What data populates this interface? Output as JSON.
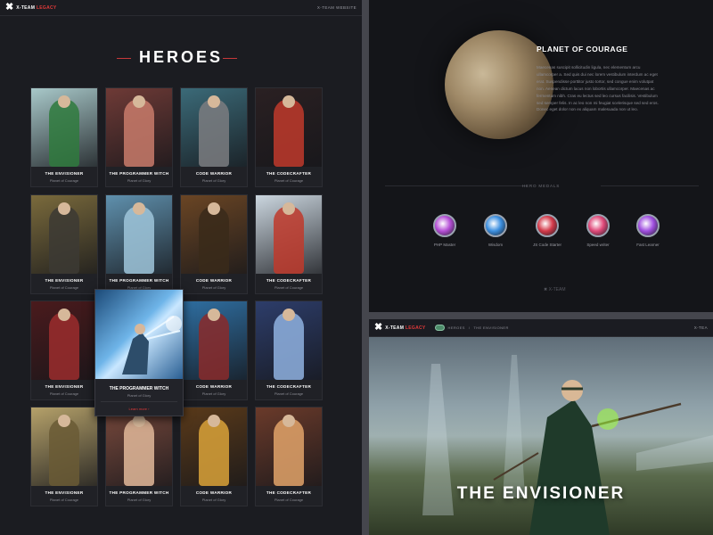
{
  "brand": {
    "name": "X-TEAM",
    "sub": "LEGACY"
  },
  "left": {
    "top_link": "X-TEAM WEBSITE",
    "title": "HEROES",
    "cards": [
      {
        "name": "THE ENVISIONER",
        "planet": "Planet of Courage",
        "bg": "#a8c8c9",
        "accent": "#2f7a3d"
      },
      {
        "name": "THE PROGRAMMER WITCH",
        "planet": "Planet of Glory",
        "bg": "#6e3a36",
        "accent": "#c97b6b"
      },
      {
        "name": "CODE WARRIOR",
        "planet": "Planet of Glory",
        "bg": "#3b6a78",
        "accent": "#7b7c80"
      },
      {
        "name": "THE CODECRAFTER",
        "planet": "Planet of Courage",
        "bg": "#2a2022",
        "accent": "#c0392b"
      },
      {
        "name": "THE ENVISIONER",
        "planet": "Planet of Courage",
        "bg": "#7a6a3c",
        "accent": "#3c3a34"
      },
      {
        "name": "THE PROGRAMMER WITCH",
        "planet": "Planet of Glory",
        "bg": "#5f90ad",
        "accent": "#9fc5db"
      },
      {
        "name": "CODE WARRIOR",
        "planet": "Planet of Glory",
        "bg": "#6a4524",
        "accent": "#3a2a1a"
      },
      {
        "name": "THE CODECRAFTER",
        "planet": "Planet of Courage",
        "bg": "#cbd6df",
        "accent": "#c0392b"
      },
      {
        "name": "THE ENVISIONER",
        "planet": "Planet of Courage",
        "bg": "#4a1a1c",
        "accent": "#9b2d2d"
      },
      {
        "name": "THE PROGRAMMER WITCH",
        "planet": "Planet of Glory",
        "bg": "#245a86",
        "accent": "#8fcbf0"
      },
      {
        "name": "CODE WARRIOR",
        "planet": "Planet of Glory",
        "bg": "#2f6fa2",
        "accent": "#8a2a2a"
      },
      {
        "name": "THE CODECRAFTER",
        "planet": "Planet of Courage",
        "bg": "#2d3d6a",
        "accent": "#8fb2e0"
      },
      {
        "name": "THE ENVISIONER",
        "planet": "Planet of Courage",
        "bg": "#b5a16a",
        "accent": "#6a5a35"
      },
      {
        "name": "THE PROGRAMMER WITCH",
        "planet": "Planet of Glory",
        "bg": "#7a4a3d",
        "accent": "#e2b89a"
      },
      {
        "name": "CODE WARRIOR",
        "planet": "Planet of Glory",
        "bg": "#5a3a1a",
        "accent": "#d9a23a"
      },
      {
        "name": "THE CODECRAFTER",
        "planet": "Planet of Courage",
        "bg": "#6a3a2a",
        "accent": "#e2a36a"
      }
    ],
    "popup": {
      "name": "THE PROGRAMMER WITCH",
      "planet": "Planet of Glory",
      "link": "Learn more ›"
    }
  },
  "planet": {
    "title": "PLANET OF COURAGE",
    "description": "Maecenas suscipit sollicitudin ligula, nec elementum arcu ullamcorper a. Sed quis dui nec lorem vestibulum interdum ac eget erat. Suspendisse porttitor justo tortor, sed congue enim volutpat non. Aenean dictum lacus non lobortis ullamcorper. Maecenas ac fermentum nibh. Cras eu lectus sed leo cursus facilisis. Vestibulum sed semper felis. In ac leo non mi feugiat scelerisque sed sed eros. Donec eget dolor non ex aliquam malesuada non ut leo.",
    "medals_label": "HERO MEDALS",
    "medals": [
      {
        "name": "PHP Master",
        "color": "#b54fd6"
      },
      {
        "name": "Wisdom",
        "color": "#3c8fe0"
      },
      {
        "name": "JS Code Starter",
        "color": "#d43a4a"
      },
      {
        "name": "Speed writer",
        "color": "#e04a7a"
      },
      {
        "name": "Fast Learner",
        "color": "#a04fe0"
      }
    ],
    "footer_logo": "X-TEAM"
  },
  "detail": {
    "crumbs": [
      "HEROES",
      "/",
      "THE ENVISIONER"
    ],
    "right_label": "X-TEA",
    "hero_title": "THE ENVISIONER"
  }
}
